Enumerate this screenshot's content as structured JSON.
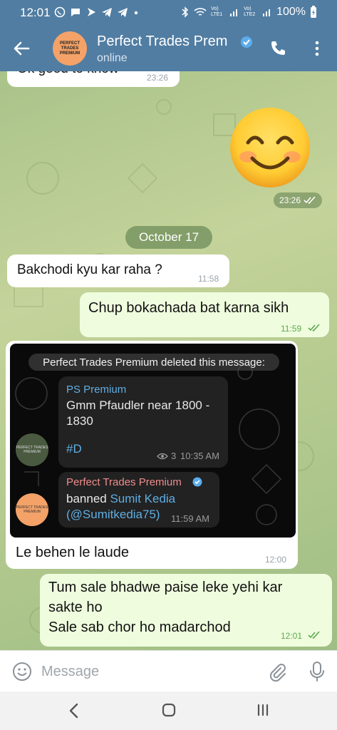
{
  "status_bar": {
    "time": "12:01",
    "battery": "100%",
    "left_icons": [
      "whatsapp-icon",
      "message-icon",
      "play-icon",
      "telegram-icon",
      "telegram-icon",
      "dot-icon"
    ],
    "right_icons": [
      "bluetooth-icon",
      "wifi-icon",
      "volte-lte1-icon",
      "signal-icon",
      "volte-lte2-icon",
      "signal-icon",
      "battery-charging-icon"
    ],
    "volte1": "Vo) LTE1",
    "volte2": "Vo) LTE2"
  },
  "header": {
    "title": "Perfect Trades Prem",
    "status": "online",
    "avatar_text": "PERFECT TRADES PREMIUM",
    "bg_color": "#517da2"
  },
  "chat": {
    "messages": [
      {
        "id": "m1",
        "direction": "in",
        "text": "Ok good to know",
        "time": "23:26"
      },
      {
        "id": "m2",
        "direction": "out",
        "type": "sticker",
        "sticker": "smiling-face-emoji",
        "time": "23:26"
      },
      {
        "id": "m3",
        "direction": "in",
        "text": "Bakchodi kyu kar raha ?",
        "time": "11:58"
      },
      {
        "id": "m4",
        "direction": "out",
        "text": "Chup bokachada bat karna sikh",
        "time": "11:59"
      },
      {
        "id": "m5",
        "direction": "in",
        "type": "photo",
        "caption": "Le behen le laude",
        "time": "12:00"
      },
      {
        "id": "m6",
        "direction": "out",
        "text_lines": [
          "Tum sale bhadwe paise leke yehi kar",
          "sakte ho",
          "Sale sab chor ho madarchod"
        ],
        "time": "12:01"
      }
    ],
    "date_separator": "October 17",
    "embedded": {
      "deleted_note": "Perfect Trades Premium deleted this message:",
      "forwarded": {
        "sender": "PS Premium",
        "text": "Gmm Pfaudler near 1800 - 1830",
        "tag": "#D",
        "views": "3",
        "time": "10:35 AM"
      },
      "ban": {
        "sender": "Perfect Trades Premium",
        "action": "banned",
        "user_name": "Sumit Kedia",
        "username": "(@Sumitkedia75)",
        "time": "11:59 AM"
      },
      "avatar_text": "PERFECT TRADES PREMIUM"
    }
  },
  "input": {
    "placeholder": "Message"
  },
  "colors": {
    "incoming": "#ffffff",
    "outgoing": "#effdde",
    "read_check": "#5ea84e",
    "link": "#5faee3"
  }
}
